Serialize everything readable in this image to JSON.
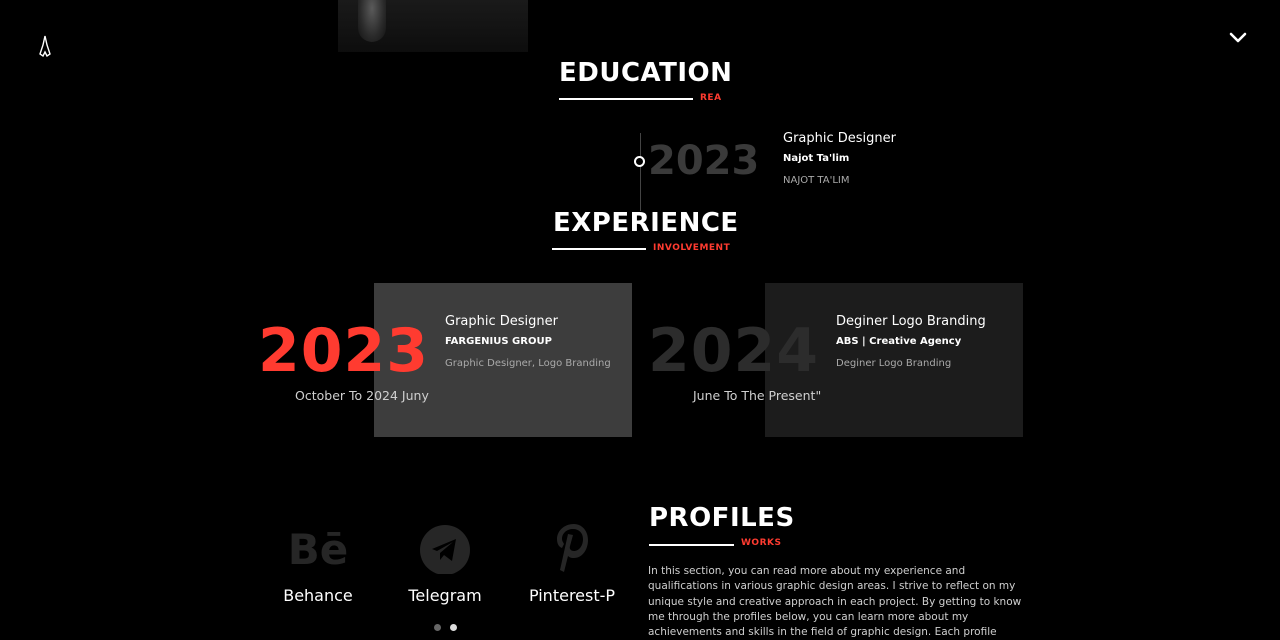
{
  "header": {
    "logo_icon": "brush-logo-icon",
    "menu_icon": "chevron-down-icon"
  },
  "education": {
    "title": "EDUCATION",
    "subtitle": "REA",
    "items": [
      {
        "year": "2023",
        "role": "Graphic Designer",
        "org": "Najot Ta'lim",
        "desc": "NAJOT TA'LIM"
      }
    ]
  },
  "experience": {
    "title": "EXPERIENCE",
    "subtitle": "INVOLVEMENT",
    "items": [
      {
        "year": "2023",
        "period": "October To 2024 Juny",
        "role": "Graphic Designer",
        "org": "FARGENIUS GROUP",
        "desc": "Graphic Designer, Logo Branding"
      },
      {
        "year": "2024",
        "period": "June To The Present\"",
        "role": "Deginer Logo Branding",
        "org": "ABS | Creative Agency",
        "desc": "Deginer Logo Branding"
      }
    ]
  },
  "profiles": {
    "title": "PROFILES",
    "subtitle": "WORKS",
    "items": [
      {
        "label": "Behance",
        "icon": "behance-icon"
      },
      {
        "label": "Telegram",
        "icon": "telegram-icon"
      },
      {
        "label": "Pinterest-P",
        "icon": "pinterest-icon"
      }
    ],
    "description": "In this section, you can read more about my experience and qualifications in various graphic design areas. I strive to reflect on my unique style and creative approach in each project. By getting to know me through the profiles below, you can learn more about my achievements and skills in the field of graphic design. Each profile details my way of working, my creative",
    "carousel_active_index": 1
  },
  "colors": {
    "accent": "#ff3b30",
    "background": "#000000",
    "card_active": "#3d3d3d",
    "card_inactive": "#1c1c1c"
  }
}
